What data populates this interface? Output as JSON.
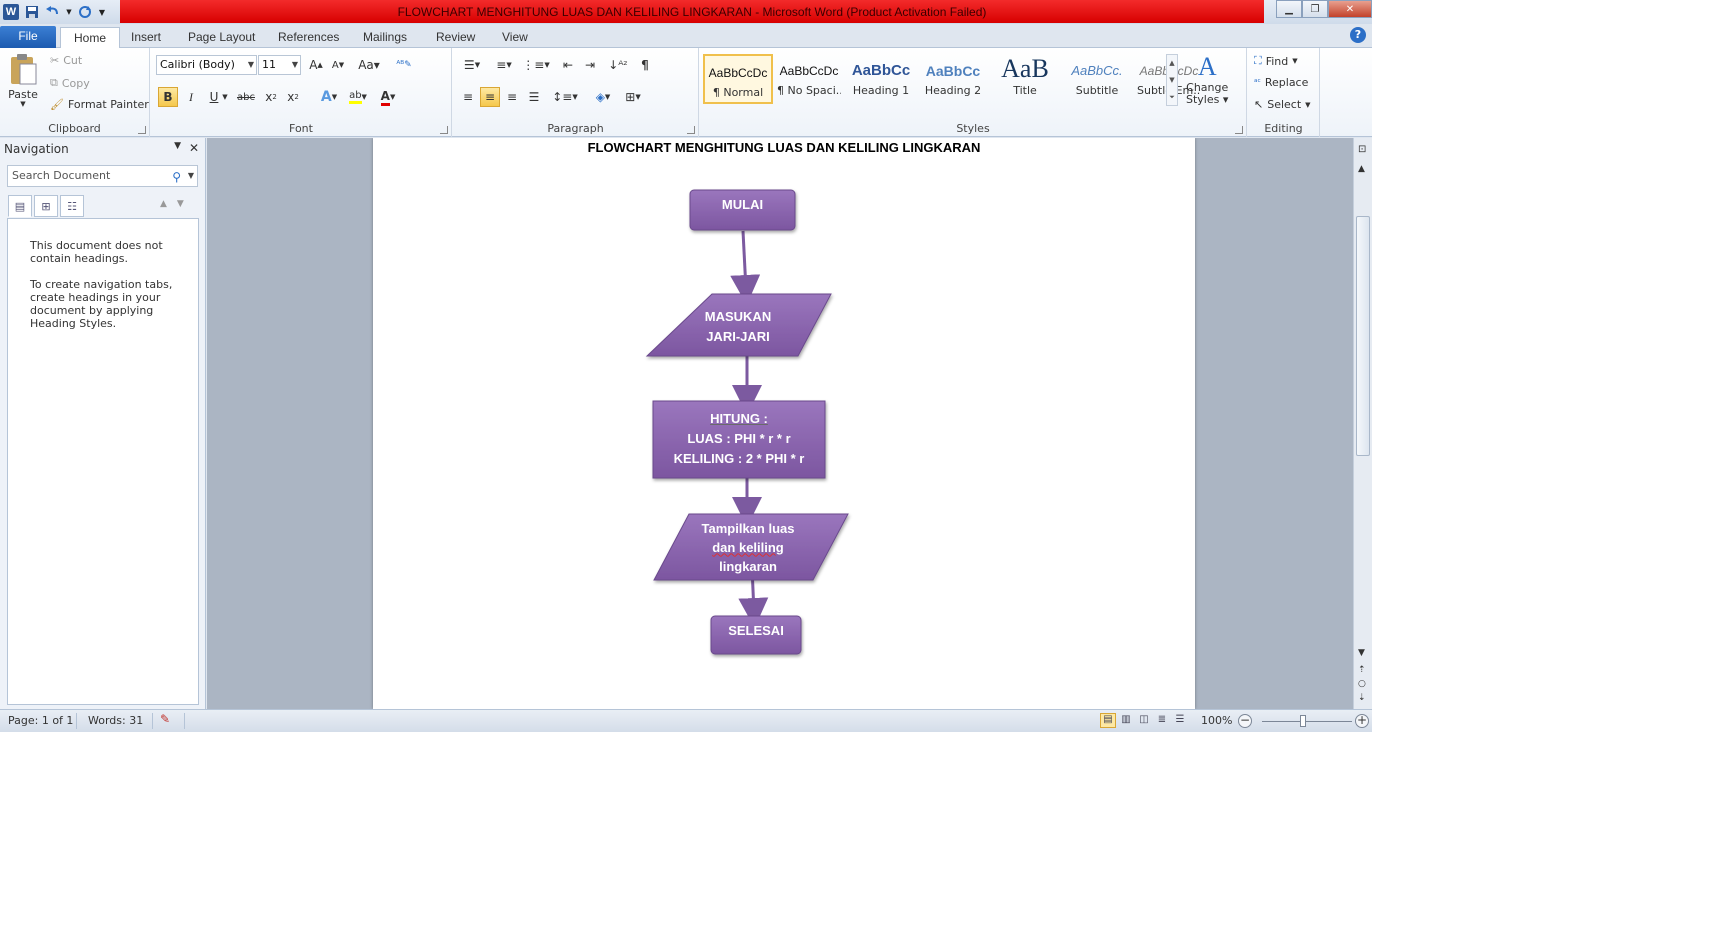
{
  "window": {
    "title": "FLOWCHART MENGHITUNG LUAS DAN KELILING LINGKARAN  -  Microsoft Word (Product Activation Failed)",
    "title_bar_color": "#e41010"
  },
  "tabs": [
    "File",
    "Home",
    "Insert",
    "Page Layout",
    "References",
    "Mailings",
    "Review",
    "View"
  ],
  "ribbon": {
    "clipboard": {
      "paste": "Paste",
      "cut": "Cut",
      "copy": "Copy",
      "format_painter": "Format Painter",
      "label": "Clipboard"
    },
    "font": {
      "font_name": "Calibri (Body)",
      "font_size": "11",
      "label": "Font"
    },
    "paragraph": {
      "label": "Paragraph"
    },
    "styles": {
      "label": "Styles",
      "items": [
        {
          "sample": "AaBbCcDc",
          "name": "¶ Normal"
        },
        {
          "sample": "AaBbCcDc",
          "name": "¶ No Spaci..."
        },
        {
          "sample": "AaBbCc",
          "name": "Heading 1"
        },
        {
          "sample": "AaBbCc",
          "name": "Heading 2"
        },
        {
          "sample": "AaB",
          "name": "Title"
        },
        {
          "sample": "AaBbCc.",
          "name": "Subtitle"
        },
        {
          "sample": "AaBbCcDc",
          "name": "Subtle Em..."
        }
      ],
      "change_styles_1": "Change",
      "change_styles_2": "Styles"
    },
    "editing": {
      "find": "Find",
      "replace": "Replace",
      "select": "Select",
      "label": "Editing"
    }
  },
  "navigation": {
    "title": "Navigation",
    "search_placeholder": "Search Document",
    "message_1": "This document does not contain headings.",
    "message_2": "To create navigation tabs, create headings in your document by applying Heading Styles."
  },
  "document": {
    "title": "FLOWCHART MENGHITUNG LUAS DAN KELILING LINGKARAN",
    "flowchart": {
      "fill_color": "#8a64ad",
      "start": "MULAI",
      "input_1": "MASUKAN",
      "input_2": "JARI-JARI",
      "process_1": "HITUNG :",
      "process_2": "LUAS : PHI * r * r",
      "process_3": "KELILING : 2 * PHI * r",
      "output_1": "Tampilkan luas",
      "output_2": "dan keliling",
      "output_3": "lingkaran",
      "end": "SELESAI"
    }
  },
  "status": {
    "page": "Page: 1 of 1",
    "words": "Words: 31",
    "zoom": "100%"
  }
}
